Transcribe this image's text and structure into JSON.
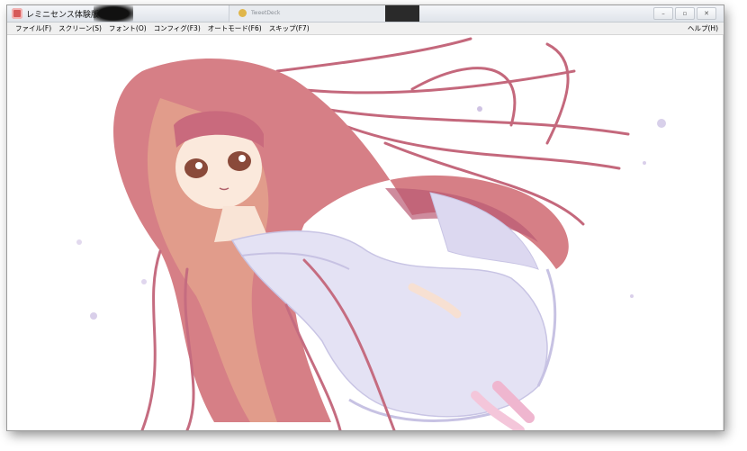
{
  "window": {
    "title": "レミニセンス体験版"
  },
  "other_tab": {
    "title": "TweetDeck"
  },
  "controls": {
    "minimize": "–",
    "maximize": "▫",
    "close": "✕"
  },
  "menu": {
    "file": "ファイル(F)",
    "screen": "スクリーン(S)",
    "font": "フォント(O)",
    "config": "コンフィグ(F3)",
    "automode": "オートモード(F6)",
    "skip": "スキップ(F7)",
    "help": "ヘルプ(H)"
  },
  "colors": {
    "hair": "#c8687a",
    "dress": "#e4e2f4",
    "accent": "#d65a5a"
  }
}
